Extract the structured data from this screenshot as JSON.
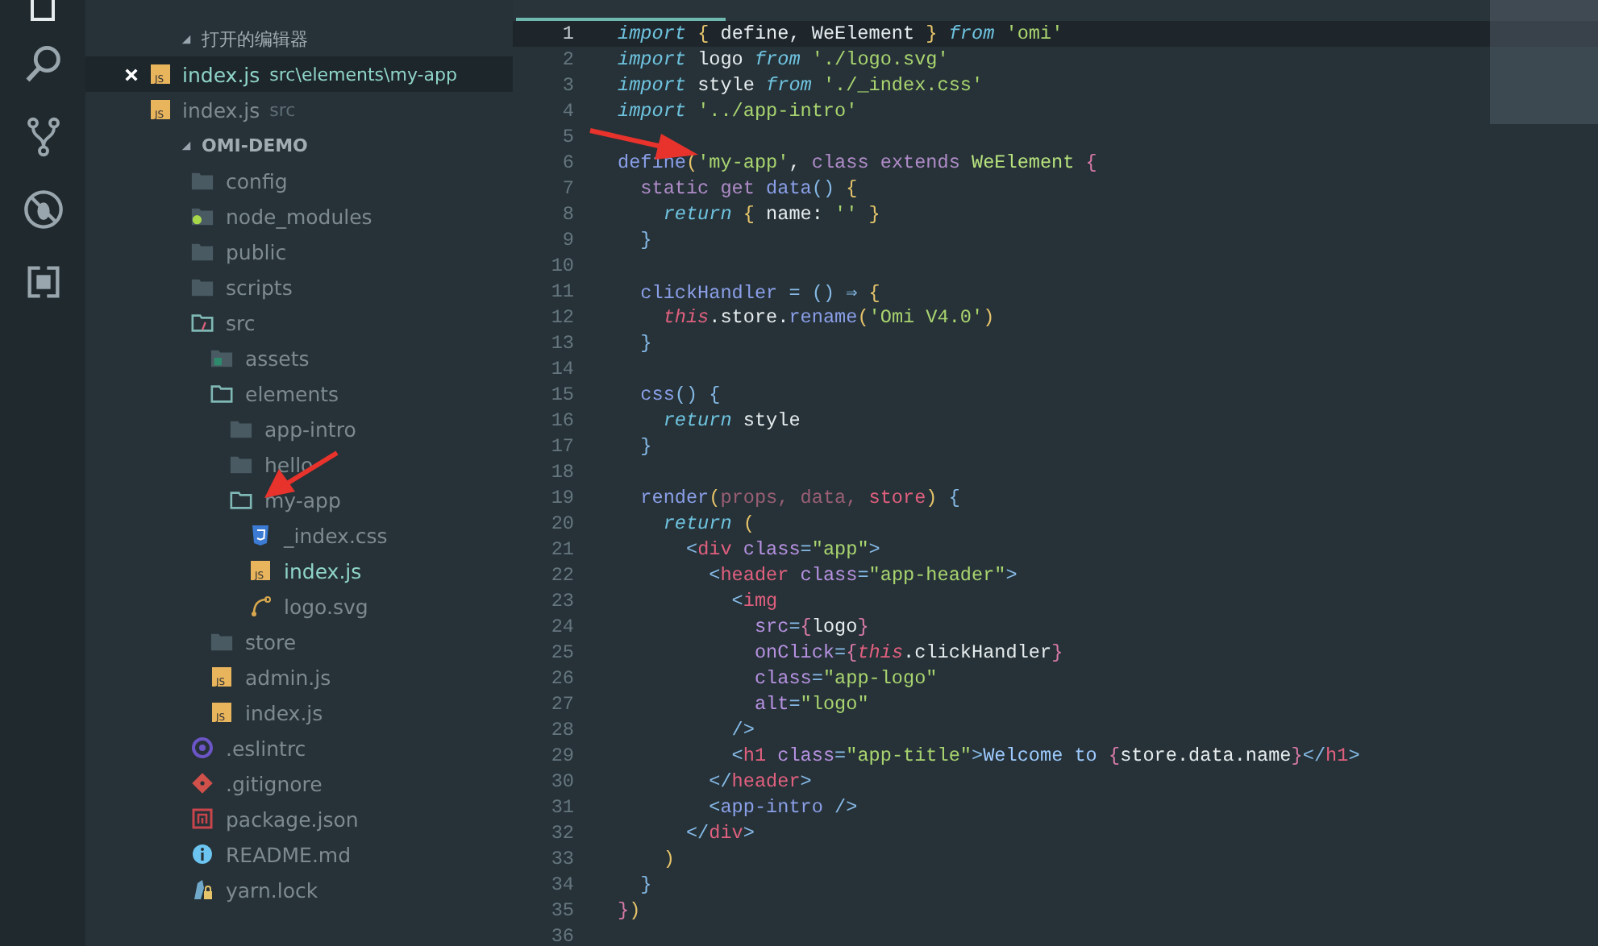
{
  "explorer": {
    "open_editors": {
      "title": "打开的编辑器",
      "expanded": true,
      "items": [
        {
          "name": "index.js",
          "path": "src\\elements\\my-app",
          "kind": "js",
          "badge": "JS",
          "selected": true
        },
        {
          "name": "index.js",
          "path": "src",
          "kind": "js",
          "badge": "JS",
          "selected": false
        }
      ]
    },
    "project": {
      "title": "OMI-DEMO",
      "expanded": true,
      "children": [
        {
          "name": "config",
          "kind": "folder",
          "expanded": false
        },
        {
          "name": "node_modules",
          "kind": "folder-node",
          "expanded": false
        },
        {
          "name": "public",
          "kind": "folder",
          "expanded": false
        },
        {
          "name": "scripts",
          "kind": "folder",
          "expanded": false
        },
        {
          "name": "src",
          "kind": "folder-src",
          "expanded": true,
          "children": [
            {
              "name": "assets",
              "kind": "folder-assets",
              "expanded": false
            },
            {
              "name": "elements",
              "kind": "folder",
              "expanded": true,
              "children": [
                {
                  "name": "app-intro",
                  "kind": "folder",
                  "expanded": false
                },
                {
                  "name": "hello",
                  "kind": "folder",
                  "expanded": false
                },
                {
                  "name": "my-app",
                  "kind": "folder",
                  "expanded": true,
                  "children": [
                    {
                      "name": "_index.css",
                      "kind": "css",
                      "active": false
                    },
                    {
                      "name": "index.js",
                      "kind": "js",
                      "badge": "JS",
                      "active": true
                    },
                    {
                      "name": "logo.svg",
                      "kind": "svg",
                      "active": false
                    }
                  ]
                }
              ]
            },
            {
              "name": "store",
              "kind": "folder",
              "expanded": false
            },
            {
              "name": "admin.js",
              "kind": "js",
              "badge": "JS",
              "active": false
            },
            {
              "name": "index.js",
              "kind": "js",
              "badge": "JS",
              "active": false
            }
          ]
        },
        {
          "name": ".eslintrc",
          "kind": "eslint",
          "active": false
        },
        {
          "name": ".gitignore",
          "kind": "git",
          "active": false
        },
        {
          "name": "package.json",
          "kind": "npm",
          "active": false
        },
        {
          "name": "README.md",
          "kind": "info",
          "active": false
        },
        {
          "name": "yarn.lock",
          "kind": "yarn",
          "active": false
        }
      ]
    }
  },
  "editor": {
    "lines": [
      {
        "number": "1",
        "current": true,
        "code": [
          {
            "kind": "kw",
            "text": "import"
          },
          {
            "kind": "pu",
            "text": " {"
          },
          {
            "kind": "p",
            "text": " define, WeElement "
          },
          {
            "kind": "pu",
            "text": "} "
          },
          {
            "kind": "kw",
            "text": "from"
          },
          {
            "kind": "str",
            "text": " 'omi'"
          }
        ]
      },
      {
        "number": "2",
        "current": false,
        "code": [
          {
            "kind": "kw",
            "text": "import"
          },
          {
            "kind": "p",
            "text": " logo "
          },
          {
            "kind": "kw",
            "text": "from"
          },
          {
            "kind": "str",
            "text": " './logo.svg'"
          }
        ]
      },
      {
        "number": "3",
        "current": false,
        "code": [
          {
            "kind": "kw",
            "text": "import"
          },
          {
            "kind": "p",
            "text": " style "
          },
          {
            "kind": "kw",
            "text": "from"
          },
          {
            "kind": "str",
            "text": " './_index.css'"
          }
        ]
      },
      {
        "number": "4",
        "current": false,
        "code": [
          {
            "kind": "kw",
            "text": "import"
          },
          {
            "kind": "str",
            "text": " '../app-intro'"
          }
        ]
      },
      {
        "number": "5",
        "current": false
      },
      {
        "number": "6",
        "current": false,
        "code": [
          {
            "kind": "fn",
            "text": "define"
          },
          {
            "kind": "pu",
            "text": "("
          },
          {
            "kind": "str",
            "text": "'my-app'"
          },
          {
            "kind": "p",
            "text": ", "
          },
          {
            "kind": "st",
            "text": "class extends"
          },
          {
            "kind": "ty",
            "text": " WeElement"
          },
          {
            "kind": "br",
            "text": " {"
          }
        ]
      },
      {
        "number": "7",
        "current": false,
        "code": [
          {
            "kind": "st",
            "text": "  static get"
          },
          {
            "kind": "fn",
            "text": " data"
          },
          {
            "kind": "op",
            "text": "()"
          },
          {
            "kind": "pu",
            "text": " {"
          }
        ]
      },
      {
        "number": "8",
        "current": false,
        "code": [
          {
            "kind": "kw",
            "text": "    return"
          },
          {
            "kind": "pu",
            "text": " {"
          },
          {
            "kind": "p",
            "text": " name: "
          },
          {
            "kind": "str",
            "text": "''"
          },
          {
            "kind": "pu",
            "text": " }"
          }
        ]
      },
      {
        "number": "9",
        "current": false,
        "code": [
          {
            "kind": "op",
            "text": "  }"
          }
        ]
      },
      {
        "number": "10",
        "current": false
      },
      {
        "number": "11",
        "current": false,
        "code": [
          {
            "kind": "fn",
            "text": "  clickHandler"
          },
          {
            "kind": "op",
            "text": " = () ⇒"
          },
          {
            "kind": "pu",
            "text": " {"
          }
        ]
      },
      {
        "number": "12",
        "current": false,
        "code": [
          {
            "kind": "th",
            "text": "    this"
          },
          {
            "kind": "p",
            "text": ".store."
          },
          {
            "kind": "fn",
            "text": "rename"
          },
          {
            "kind": "pu",
            "text": "("
          },
          {
            "kind": "str",
            "text": "'Omi V4.0'"
          },
          {
            "kind": "pu",
            "text": ")"
          }
        ]
      },
      {
        "number": "13",
        "current": false,
        "code": [
          {
            "kind": "op",
            "text": "  }"
          }
        ]
      },
      {
        "number": "14",
        "current": false
      },
      {
        "number": "15",
        "current": false,
        "code": [
          {
            "kind": "fn",
            "text": "  css"
          },
          {
            "kind": "op",
            "text": "() {"
          }
        ]
      },
      {
        "number": "16",
        "current": false,
        "code": [
          {
            "kind": "kw",
            "text": "    return"
          },
          {
            "kind": "p",
            "text": " style"
          }
        ]
      },
      {
        "number": "17",
        "current": false,
        "code": [
          {
            "kind": "op",
            "text": "  }"
          }
        ]
      },
      {
        "number": "18",
        "current": false
      },
      {
        "number": "19",
        "current": false,
        "code": [
          {
            "kind": "fn",
            "text": "  render"
          },
          {
            "kind": "pu",
            "text": "("
          },
          {
            "kind": "pa",
            "text": "props, data,"
          },
          {
            "kind": "pr",
            "text": " store"
          },
          {
            "kind": "pu",
            "text": ")"
          },
          {
            "kind": "op",
            "text": " {"
          }
        ]
      },
      {
        "number": "20",
        "current": false,
        "code": [
          {
            "kind": "kw",
            "text": "    return"
          },
          {
            "kind": "pu",
            "text": " ("
          }
        ]
      },
      {
        "number": "21",
        "current": false,
        "code": [
          {
            "kind": "op",
            "text": "      <"
          },
          {
            "kind": "tg",
            "text": "div"
          },
          {
            "kind": "at",
            "text": " class"
          },
          {
            "kind": "op",
            "text": "="
          },
          {
            "kind": "str",
            "text": "\"app\""
          },
          {
            "kind": "op",
            "text": ">"
          }
        ]
      },
      {
        "number": "22",
        "current": false,
        "code": [
          {
            "kind": "op",
            "text": "        <"
          },
          {
            "kind": "tg",
            "text": "header"
          },
          {
            "kind": "at",
            "text": " class"
          },
          {
            "kind": "op",
            "text": "="
          },
          {
            "kind": "str",
            "text": "\"app-header\""
          },
          {
            "kind": "op",
            "text": ">"
          }
        ]
      },
      {
        "number": "23",
        "current": false,
        "code": [
          {
            "kind": "op",
            "text": "          <"
          },
          {
            "kind": "tg",
            "text": "img"
          }
        ]
      },
      {
        "number": "24",
        "current": false,
        "code": [
          {
            "kind": "at",
            "text": "            src"
          },
          {
            "kind": "op",
            "text": "="
          },
          {
            "kind": "br",
            "text": "{"
          },
          {
            "kind": "p",
            "text": "logo"
          },
          {
            "kind": "br",
            "text": "}"
          }
        ]
      },
      {
        "number": "25",
        "current": false,
        "code": [
          {
            "kind": "at",
            "text": "            onClick"
          },
          {
            "kind": "op",
            "text": "="
          },
          {
            "kind": "br",
            "text": "{"
          },
          {
            "kind": "th",
            "text": "this"
          },
          {
            "kind": "p",
            "text": ".clickHandler"
          },
          {
            "kind": "br",
            "text": "}"
          }
        ]
      },
      {
        "number": "26",
        "current": false,
        "code": [
          {
            "kind": "at",
            "text": "            class"
          },
          {
            "kind": "op",
            "text": "="
          },
          {
            "kind": "str",
            "text": "\"app-logo\""
          }
        ]
      },
      {
        "number": "27",
        "current": false,
        "code": [
          {
            "kind": "at",
            "text": "            alt"
          },
          {
            "kind": "op",
            "text": "="
          },
          {
            "kind": "str",
            "text": "\"logo\""
          }
        ]
      },
      {
        "number": "28",
        "current": false,
        "code": [
          {
            "kind": "op",
            "text": "          />"
          }
        ]
      },
      {
        "number": "29",
        "current": false,
        "code": [
          {
            "kind": "op",
            "text": "          <"
          },
          {
            "kind": "tg",
            "text": "h1"
          },
          {
            "kind": "at",
            "text": " class"
          },
          {
            "kind": "op",
            "text": "="
          },
          {
            "kind": "str",
            "text": "\"app-title\""
          },
          {
            "kind": "op",
            "text": ">"
          },
          {
            "kind": "tx",
            "text": "Welcome to"
          },
          {
            "kind": "br",
            "text": " {"
          },
          {
            "kind": "p",
            "text": "store.data.name"
          },
          {
            "kind": "br",
            "text": "}"
          },
          {
            "kind": "op",
            "text": "</"
          },
          {
            "kind": "tg",
            "text": "h1"
          },
          {
            "kind": "op",
            "text": ">"
          }
        ]
      },
      {
        "number": "30",
        "current": false,
        "code": [
          {
            "kind": "op",
            "text": "        </"
          },
          {
            "kind": "tg",
            "text": "header"
          },
          {
            "kind": "op",
            "text": ">"
          }
        ]
      },
      {
        "number": "31",
        "current": false,
        "code": [
          {
            "kind": "op",
            "text": "        <"
          },
          {
            "kind": "fn",
            "text": "app-intro"
          },
          {
            "kind": "op",
            "text": " />"
          }
        ]
      },
      {
        "number": "32",
        "current": false,
        "code": [
          {
            "kind": "op",
            "text": "      </"
          },
          {
            "kind": "tg",
            "text": "div"
          },
          {
            "kind": "op",
            "text": ">"
          }
        ]
      },
      {
        "number": "33",
        "current": false,
        "code": [
          {
            "kind": "pu",
            "text": "    )"
          }
        ]
      },
      {
        "number": "34",
        "current": false,
        "code": [
          {
            "kind": "op",
            "text": "  }"
          }
        ]
      },
      {
        "number": "35",
        "current": false,
        "code": [
          {
            "kind": "br",
            "text": "}"
          },
          {
            "kind": "pu",
            "text": ")"
          }
        ]
      },
      {
        "number": "36",
        "current": false
      }
    ]
  }
}
